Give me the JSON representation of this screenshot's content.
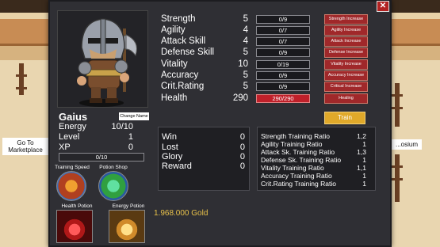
{
  "background": {
    "left_label": "Go To Marketplace",
    "right_label": "...osium"
  },
  "character": {
    "name": "Gaius",
    "change_name_label": "Change Name",
    "energy_label": "Energy",
    "energy_value": "10/10",
    "level_label": "Level",
    "level_value": "1",
    "xp_label": "XP",
    "xp_value": "0",
    "xp_bar_text": "0/10",
    "xp_progress": 0
  },
  "stats": [
    {
      "name": "Strength",
      "value": "5",
      "bar": "0/9",
      "button": "Strength Increase"
    },
    {
      "name": "Agility",
      "value": "4",
      "bar": "0/7",
      "button": "Agility Increase"
    },
    {
      "name": "Attack Skill",
      "value": "4",
      "bar": "0/7",
      "button": "Attack Increase"
    },
    {
      "name": "Defense Skill",
      "value": "5",
      "bar": "0/9",
      "button": "Defense Increase"
    },
    {
      "name": "Vitality",
      "value": "10",
      "bar": "0/19",
      "button": "Vitality Increase"
    },
    {
      "name": "Accuracy",
      "value": "5",
      "bar": "0/9",
      "button": "Accuracy Increase"
    },
    {
      "name": "Crit.Rating",
      "value": "5",
      "bar": "0/9",
      "button": "Critical Increase"
    },
    {
      "name": "Health",
      "value": "290",
      "bar": "290/290",
      "button": "Healing"
    }
  ],
  "train_label": "Train",
  "shops": {
    "training_speed_label": "Training Speed",
    "potion_shop_label": "Potion Shop",
    "health_potion_label": "Health Potion",
    "energy_potion_label": "Energy Potion"
  },
  "record": [
    {
      "label": "Win",
      "value": "0"
    },
    {
      "label": "Lost",
      "value": "0"
    },
    {
      "label": "Glory",
      "value": "0"
    },
    {
      "label": "Reward",
      "value": "0"
    }
  ],
  "ratios": [
    {
      "label": "Strength Training Ratio",
      "value": "1,2"
    },
    {
      "label": "Agility Training Ratio",
      "value": "1"
    },
    {
      "label": "Attack Sk. Training Ratio",
      "value": "1,3"
    },
    {
      "label": "Defense Sk. Training Ratio",
      "value": "1"
    },
    {
      "label": "Vitality Training Ratio",
      "value": "1,1"
    },
    {
      "label": "Accuracy Training Ratio",
      "value": "1"
    },
    {
      "label": "Crit.Rating Training Ratio",
      "value": "1"
    }
  ],
  "gold": "1.968.000 Gold",
  "colors": {
    "button_red": "#a0282a",
    "train_gold": "#e0a92a",
    "gold_text": "#e8c14a",
    "health_bar": "#c0202a"
  }
}
